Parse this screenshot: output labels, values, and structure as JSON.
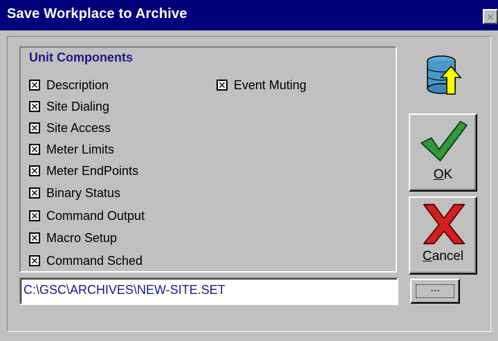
{
  "window": {
    "title": "Save Workplace to Archive",
    "close_glyph": "×"
  },
  "group": {
    "title": "Unit Components",
    "checkboxes_left": [
      {
        "label": "Description",
        "checked": true
      },
      {
        "label": "Site Dialing",
        "checked": true
      },
      {
        "label": "Site Access",
        "checked": true
      },
      {
        "label": "Meter Limits",
        "checked": true
      },
      {
        "label": "Meter EndPoints",
        "checked": true
      },
      {
        "label": "Binary Status",
        "checked": true
      },
      {
        "label": "Command Output",
        "checked": true
      },
      {
        "label": "Macro Setup",
        "checked": true
      },
      {
        "label": "Command Sched",
        "checked": true
      }
    ],
    "checkboxes_right": [
      {
        "label": "Event Muting",
        "checked": true
      }
    ]
  },
  "path": {
    "value": "C:\\GSC\\ARCHIVES\\NEW-SITE.SET"
  },
  "browse_label": "...",
  "ok_button": {
    "mnemonic": "O",
    "rest": "K"
  },
  "cancel_button": {
    "mnemonic": "C",
    "rest": "ancel"
  },
  "icons": {
    "archive": "database-upload-icon",
    "ok": "checkmark-icon",
    "cancel": "x-mark-icon"
  }
}
